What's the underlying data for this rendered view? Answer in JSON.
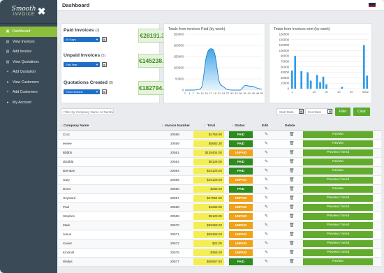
{
  "app": {
    "logo_main": "Smooth",
    "logo_sub": "INVOICE",
    "page_title": "Dashboard"
  },
  "sidebar": {
    "items": [
      {
        "label": "Dashboard",
        "icon": "dashboard-icon",
        "active": true
      },
      {
        "label": "View Invoices",
        "icon": "document-icon"
      },
      {
        "label": "Add Invoice",
        "icon": "document-icon"
      },
      {
        "label": "View Quotations",
        "icon": "document-icon"
      },
      {
        "label": "Add Quotation",
        "icon": "plus-icon"
      },
      {
        "label": "View Customers",
        "icon": "user-icon"
      },
      {
        "label": "Add Customers",
        "icon": "plus-icon"
      },
      {
        "label": "My Account",
        "icon": "user-icon"
      }
    ]
  },
  "stats": [
    {
      "title": "Paid Invoices",
      "count": "(3)",
      "period": "30 Days",
      "value": "€28191.36"
    },
    {
      "title": "Unpaid Invoices",
      "count": "(5)",
      "period": "This Year",
      "value": "€145238.40"
    },
    {
      "title": "Quotations Created",
      "count": "(9)",
      "period": "Three Months",
      "value": "€182794.80"
    }
  ],
  "chart_data": [
    {
      "type": "area",
      "title": "Totals from invoices Paid (by week)",
      "x": [
        1,
        4,
        7,
        10,
        13,
        16,
        17,
        19,
        21,
        24,
        27,
        30,
        33,
        36,
        39,
        42,
        45,
        48,
        52
      ],
      "x_ticks": [
        "1",
        "4",
        "7",
        "10",
        "13",
        "16",
        "17",
        "19",
        "21",
        "24",
        "27",
        "30",
        "33",
        "36",
        "39",
        "42",
        "45",
        "48",
        "52"
      ],
      "values": [
        0,
        0,
        0,
        2000,
        18000,
        150000,
        185000,
        160000,
        40000,
        15000,
        2000,
        0,
        0,
        0,
        20000,
        18000,
        16000,
        8000,
        4000
      ],
      "ylim": [
        0,
        250000
      ],
      "y_ticks": [
        "0",
        "50000",
        "100000",
        "150000",
        "200000",
        "250000"
      ],
      "grid": true
    },
    {
      "type": "bar",
      "title": "Totals from invoices sent (by week)",
      "categories": [
        "1",
        "",
        "",
        "",
        "",
        "",
        "",
        "10",
        "",
        "",
        "",
        "20",
        "",
        "",
        "",
        "30",
        "",
        "",
        "",
        "40",
        "",
        "",
        "",
        "50",
        "52"
      ],
      "x_ticks": [
        "1",
        "10",
        "20",
        "30",
        "40",
        "50"
      ],
      "values": [
        50000,
        90000,
        0,
        48000,
        0,
        45000,
        22000,
        0,
        38000,
        18000,
        33000,
        12000,
        0,
        0,
        0,
        0,
        5000,
        0,
        0,
        0,
        0,
        0,
        0,
        120000,
        36000
      ],
      "ylim": [
        0,
        150000
      ],
      "y_ticks": [
        "0",
        "15000",
        "30000",
        "45000",
        "60000",
        "75000",
        "90000",
        "105000",
        "120000",
        "135000",
        "150000"
      ],
      "grid": true,
      "color": "#2e9be6"
    }
  ],
  "filters": {
    "company_placeholder": "Filter by Company Name or Number",
    "start_placeholder": "Start Date",
    "end_placeholder": "End Date",
    "filter_label": "Filter",
    "clear_label": "Clear"
  },
  "table": {
    "headers": {
      "company": "Company Name",
      "invoice": "Invoice Number",
      "total": "Total",
      "status": "Status",
      "edit": "Edit",
      "delete": "Delete"
    },
    "rows": [
      {
        "company": "Cccc",
        "invoice": "20558",
        "total": "$1758.90",
        "status": "PAID",
        "action": "Review"
      },
      {
        "company": "eeeee",
        "invoice": "20559",
        "total": "$5882.30",
        "status": "PAID",
        "action": "Review"
      },
      {
        "company": "Bbbbb",
        "invoice": "20561",
        "total": "$138404.00",
        "status": "UNPAID",
        "action": "Preview / Send"
      },
      {
        "company": "dddddd",
        "invoice": "20562",
        "total": "$5129.00",
        "status": "PAID",
        "action": "Review"
      },
      {
        "company": "Brendan",
        "invoice": "20564",
        "total": "$15129.00",
        "status": "PAID",
        "action": "Review"
      },
      {
        "company": "Gary",
        "invoice": "20565",
        "total": "$15129.00",
        "status": "UNPAID",
        "action": "Preview / Send"
      },
      {
        "company": "Dona",
        "invoice": "20566",
        "total": "$288.00",
        "status": "PAID",
        "action": "Review"
      },
      {
        "company": "Heyward",
        "invoice": "20567",
        "total": "$27564.00",
        "status": "UNPAID",
        "action": "Preview / Send"
      },
      {
        "company": "Paul",
        "invoice": "20568",
        "total": "$1268.00",
        "status": "UNPAID",
        "action": "Preview / Send"
      },
      {
        "company": "Stephen",
        "invoice": "20569",
        "total": "$5129.00",
        "status": "UNPAID",
        "action": "Preview / Send"
      },
      {
        "company": "Mark",
        "invoice": "20570",
        "total": "$69258.00",
        "status": "UNPAID",
        "action": "Preview / Send"
      },
      {
        "company": "Jesus",
        "invoice": "20571",
        "total": "$69258.00",
        "status": "UNPAID",
        "action": "Preview / Send"
      },
      {
        "company": "Xavier",
        "invoice": "20572",
        "total": "$22.00",
        "status": "UNPAID",
        "action": "Preview / Send"
      },
      {
        "company": "Kinsmill",
        "invoice": "20575",
        "total": "$356.00",
        "status": "UNPAID",
        "action": "Preview / Send"
      },
      {
        "company": "Waltys",
        "invoice": "20577",
        "total": "$96567.60",
        "status": "PAID",
        "action": "Review"
      }
    ]
  }
}
